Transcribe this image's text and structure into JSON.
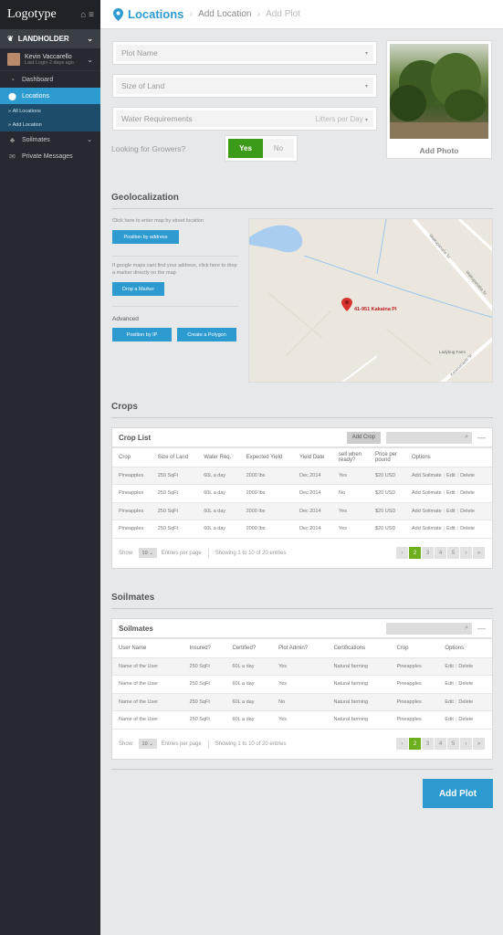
{
  "sidebar": {
    "logo": "Logotype",
    "role": "LANDHOLDER",
    "user_name": "Kevin Vaccarello",
    "user_sub": "Last Login 2 days ago",
    "nav": {
      "dashboard": "Dashboard",
      "locations": "Locations",
      "all_locations": "All Locations",
      "add_location": "Add Location",
      "soilmates": "Soilmates",
      "private_messages": "Private Messages"
    }
  },
  "header": {
    "title": "Locations",
    "crumb1": "Add Location",
    "crumb2": "Add Plot"
  },
  "form": {
    "plot_name": "Plot Name",
    "size_of_land": "Size of Land",
    "water_requirements": "Water Requirements",
    "water_unit": "Litters per Day",
    "growers_label": "Looking for Growers?",
    "yes": "Yes",
    "no": "No",
    "add_photo": "Add Photo"
  },
  "geo": {
    "title": "Geolocalization",
    "text1": "Click here to enter map by street location",
    "btn_address": "Position by address",
    "text2": "If google maps cant find your address, click here to drop a marker directly on the map",
    "btn_marker": "Drop a Marker",
    "advanced": "Advanced",
    "btn_ip": "Position by IP",
    "btn_polygon": "Create a Polygon",
    "map_pin_label": "41-951 Kakaina Pl",
    "map_street1": "Waikupanaha St",
    "map_street2": "Waikupanaha St",
    "map_street3": "Kalanianaole St",
    "map_place": "Ladybug Farm"
  },
  "crops": {
    "section_title": "Crops",
    "card_title": "Crop List",
    "add_btn": "Add Crop",
    "columns": [
      "Crop",
      "Size of Land",
      "Water Req.",
      "Expected Yield",
      "Yield Date",
      "sell when ready?",
      "Price per pound",
      "Options"
    ],
    "rows": [
      {
        "crop": "Pineapples",
        "size": "250 SqFt",
        "water": "60L a day",
        "yield": "2000 lbs",
        "date": "Dec 2014",
        "sell": "Yes",
        "price": "$20 USD"
      },
      {
        "crop": "Pineapples",
        "size": "250 SqFt",
        "water": "60L a day",
        "yield": "2000 lbs",
        "date": "Dec 2014",
        "sell": "No",
        "price": "$20 USD"
      },
      {
        "crop": "Pineapples",
        "size": "250 SqFt",
        "water": "60L a day",
        "yield": "2000 lbs",
        "date": "Dec 2014",
        "sell": "Yes",
        "price": "$20 USD"
      },
      {
        "crop": "Pineapples",
        "size": "250 SqFt",
        "water": "60L a day",
        "yield": "2000 lbs",
        "date": "Dec 2014",
        "sell": "Yes",
        "price": "$20 USD"
      }
    ],
    "options": {
      "add": "Add Soilmate",
      "edit": "Edit",
      "delete": "Delete"
    },
    "footer": {
      "show": "Show:",
      "per_value": "10",
      "per_page": "Entries per page",
      "showing": "Showing 1 to 10 of 20 entries"
    },
    "pages": [
      "‹",
      "2",
      "3",
      "4",
      "5",
      "›",
      "»"
    ]
  },
  "soilmates": {
    "section_title": "Soilmates",
    "card_title": "Soilmates",
    "columns": [
      "User Name",
      "Insured?",
      "Certified?",
      "Plot Admin?",
      "Certifications",
      "Crop",
      "Options"
    ],
    "rows": [
      {
        "user": "Name of the User",
        "insured": "250 SqFt",
        "certified": "60L a day",
        "admin": "Yes",
        "certs": "Natural farming",
        "crop": "Pineapples"
      },
      {
        "user": "Name of the User",
        "insured": "250 SqFt",
        "certified": "60L a day",
        "admin": "Yes",
        "certs": "Natural farming",
        "crop": "Pineapples"
      },
      {
        "user": "Name of the User",
        "insured": "250 SqFt",
        "certified": "60L a day",
        "admin": "No",
        "certs": "Natural farming",
        "crop": "Pineapples"
      },
      {
        "user": "Name of the User",
        "insured": "250 SqFt",
        "certified": "60L a day",
        "admin": "Yes",
        "certs": "Natural farming",
        "crop": "Pineapples"
      }
    ],
    "options": {
      "edit": "Edit",
      "delete": "Delete"
    },
    "footer": {
      "show": "Show:",
      "per_value": "10",
      "per_page": "Entries per page",
      "showing": "Showing 1 to 10 of 20 entries"
    },
    "pages": [
      "‹",
      "2",
      "3",
      "4",
      "5",
      "›",
      "»"
    ]
  },
  "add_plot": "Add Plot",
  "colors": {
    "accent": "#2e9bd0",
    "success": "#3b9a17",
    "pager_active": "#6cae1c",
    "sidebar_bg": "#26292f"
  }
}
